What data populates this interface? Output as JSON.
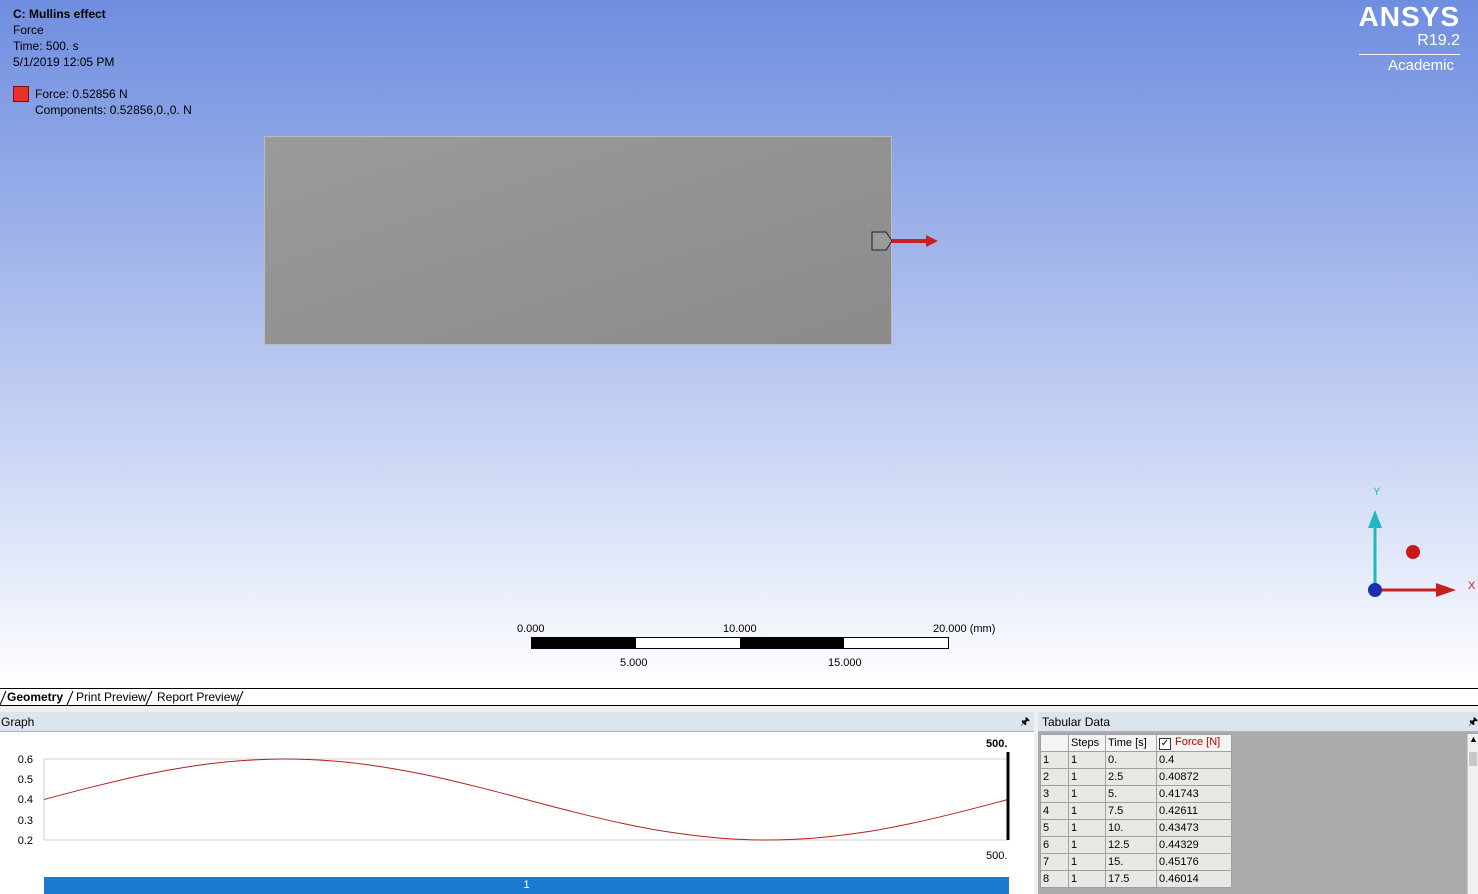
{
  "viewport": {
    "title": "C: Mullins effect",
    "object": "Force",
    "time": "Time: 500. s",
    "date": "5/1/2019 12:05 PM",
    "legend_force": "Force: 0.52856 N",
    "legend_components": "Components: 0.52856,0.,0. N",
    "force_color": "#e8312a"
  },
  "brand": {
    "name": "ANSYS",
    "version": "R19.2",
    "edition": "Academic"
  },
  "scale": {
    "l0": "0.000",
    "l10": "10.000",
    "l20": "20.000 (mm)",
    "l5": "5.000",
    "l15": "15.000"
  },
  "triad": {
    "y": "Y",
    "x": "X"
  },
  "tabs": [
    {
      "label": "Geometry"
    },
    {
      "label": "Print Preview"
    },
    {
      "label": "Report Preview"
    }
  ],
  "graph": {
    "title": "Graph",
    "pin": "ᴾ",
    "yticks": [
      "0.6",
      "0.5",
      "0.4",
      "0.3",
      "0.2"
    ],
    "end_top": "500.",
    "end_bottom": "500.",
    "timeline": "1"
  },
  "tabular": {
    "title": "Tabular Data",
    "headers": [
      "Steps",
      "Time [s]",
      "Force [N]"
    ],
    "rows": [
      [
        "1",
        "1",
        "0.",
        "0.4"
      ],
      [
        "2",
        "1",
        "2.5",
        "0.40872"
      ],
      [
        "3",
        "1",
        "5.",
        "0.41743"
      ],
      [
        "4",
        "1",
        "7.5",
        "0.42611"
      ],
      [
        "5",
        "1",
        "10.",
        "0.43473"
      ],
      [
        "6",
        "1",
        "12.5",
        "0.44329"
      ],
      [
        "7",
        "1",
        "15.",
        "0.45176"
      ],
      [
        "8",
        "1",
        "17.5",
        "0.46014"
      ]
    ]
  },
  "chart_data": {
    "type": "line",
    "title": "",
    "xlabel": "",
    "ylabel": "",
    "xlim": [
      0,
      500
    ],
    "ylim": [
      0.2,
      0.6
    ],
    "series": [
      {
        "x": [
          0,
          25,
          50,
          75,
          100,
          125,
          150,
          175,
          200,
          225,
          250,
          275,
          300,
          325,
          350,
          375,
          400,
          425,
          450,
          475,
          500
        ],
        "values": [
          0.4,
          0.462,
          0.518,
          0.562,
          0.59,
          0.6,
          0.59,
          0.562,
          0.518,
          0.462,
          0.4,
          0.338,
          0.282,
          0.238,
          0.21,
          0.2,
          0.21,
          0.238,
          0.282,
          0.338,
          0.4
        ]
      }
    ],
    "line_color": "#b02020"
  }
}
